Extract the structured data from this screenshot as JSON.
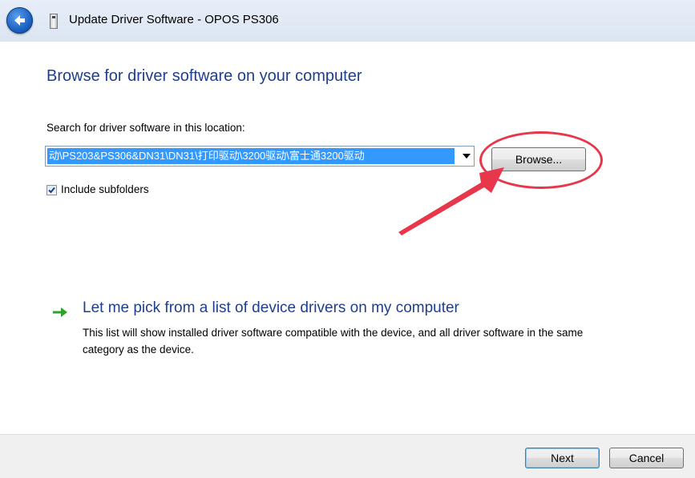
{
  "window": {
    "title": "Update Driver Software - OPOS PS306",
    "back_icon": "back-arrow-icon",
    "device_icon": "device-icon"
  },
  "main": {
    "heading": "Browse for driver software on your computer",
    "search_label": "Search for driver software in this location:",
    "path_value": "动\\PS203&PS306&DN31\\DN31\\打印驱动\\3200驱动\\富士通3200驱动",
    "browse_label": "Browse...",
    "include_subfolders_label": "Include subfolders",
    "include_subfolders_checked": true
  },
  "pick": {
    "title": "Let me pick from a list of device drivers on my computer",
    "description": "This list will show installed driver software compatible with the device, and all driver software in the same category as the device."
  },
  "footer": {
    "next_label": "Next",
    "cancel_label": "Cancel"
  },
  "colors": {
    "heading": "#1e3f8c",
    "selection": "#3399ff",
    "annotation": "#e8364a",
    "green_arrow": "#2fa12f"
  }
}
